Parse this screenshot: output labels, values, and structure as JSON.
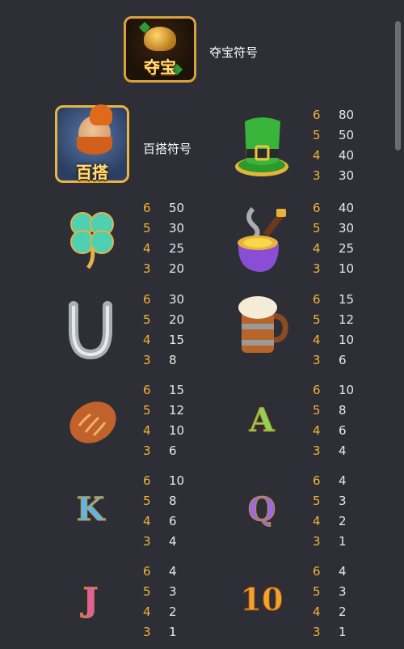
{
  "scatter": {
    "icon": "treasure-pot-icon",
    "label": "夺宝符号",
    "badge": "夺宝"
  },
  "wild": {
    "icon": "leprechaun-icon",
    "label": "百搭符号",
    "badge": "百搭"
  },
  "symbols": [
    {
      "id": "hat",
      "icon": "green-top-hat-icon",
      "pays": [
        {
          "n": "6",
          "v": "80"
        },
        {
          "n": "5",
          "v": "50"
        },
        {
          "n": "4",
          "v": "40"
        },
        {
          "n": "3",
          "v": "30"
        }
      ]
    },
    {
      "id": "clover",
      "icon": "four-leaf-clover-icon",
      "pays": [
        {
          "n": "6",
          "v": "50"
        },
        {
          "n": "5",
          "v": "30"
        },
        {
          "n": "4",
          "v": "25"
        },
        {
          "n": "3",
          "v": "20"
        }
      ]
    },
    {
      "id": "pipe",
      "icon": "smoking-pipe-icon",
      "pays": [
        {
          "n": "6",
          "v": "40"
        },
        {
          "n": "5",
          "v": "30"
        },
        {
          "n": "4",
          "v": "25"
        },
        {
          "n": "3",
          "v": "10"
        }
      ]
    },
    {
      "id": "horseshoe",
      "icon": "horseshoe-icon",
      "pays": [
        {
          "n": "6",
          "v": "30"
        },
        {
          "n": "5",
          "v": "20"
        },
        {
          "n": "4",
          "v": "15"
        },
        {
          "n": "3",
          "v": "8"
        }
      ]
    },
    {
      "id": "mug",
      "icon": "beer-mug-icon",
      "pays": [
        {
          "n": "6",
          "v": "15"
        },
        {
          "n": "5",
          "v": "12"
        },
        {
          "n": "4",
          "v": "10"
        },
        {
          "n": "3",
          "v": "6"
        }
      ]
    },
    {
      "id": "bread",
      "icon": "bread-loaf-icon",
      "pays": [
        {
          "n": "6",
          "v": "15"
        },
        {
          "n": "5",
          "v": "12"
        },
        {
          "n": "4",
          "v": "10"
        },
        {
          "n": "3",
          "v": "6"
        }
      ]
    },
    {
      "id": "a",
      "icon": "letter-a-icon",
      "glyph": "A",
      "pays": [
        {
          "n": "6",
          "v": "10"
        },
        {
          "n": "5",
          "v": "8"
        },
        {
          "n": "4",
          "v": "6"
        },
        {
          "n": "3",
          "v": "4"
        }
      ]
    },
    {
      "id": "k",
      "icon": "letter-k-icon",
      "glyph": "K",
      "pays": [
        {
          "n": "6",
          "v": "10"
        },
        {
          "n": "5",
          "v": "8"
        },
        {
          "n": "4",
          "v": "6"
        },
        {
          "n": "3",
          "v": "4"
        }
      ]
    },
    {
      "id": "q",
      "icon": "letter-q-icon",
      "glyph": "Q",
      "pays": [
        {
          "n": "6",
          "v": "4"
        },
        {
          "n": "5",
          "v": "3"
        },
        {
          "n": "4",
          "v": "2"
        },
        {
          "n": "3",
          "v": "1"
        }
      ]
    },
    {
      "id": "j",
      "icon": "letter-j-icon",
      "glyph": "J",
      "pays": [
        {
          "n": "6",
          "v": "4"
        },
        {
          "n": "5",
          "v": "3"
        },
        {
          "n": "4",
          "v": "2"
        },
        {
          "n": "3",
          "v": "1"
        }
      ]
    },
    {
      "id": "ten",
      "icon": "number-10-icon",
      "glyph": "10",
      "pays": [
        {
          "n": "6",
          "v": "4"
        },
        {
          "n": "5",
          "v": "3"
        },
        {
          "n": "4",
          "v": "2"
        },
        {
          "n": "3",
          "v": "1"
        }
      ]
    }
  ]
}
